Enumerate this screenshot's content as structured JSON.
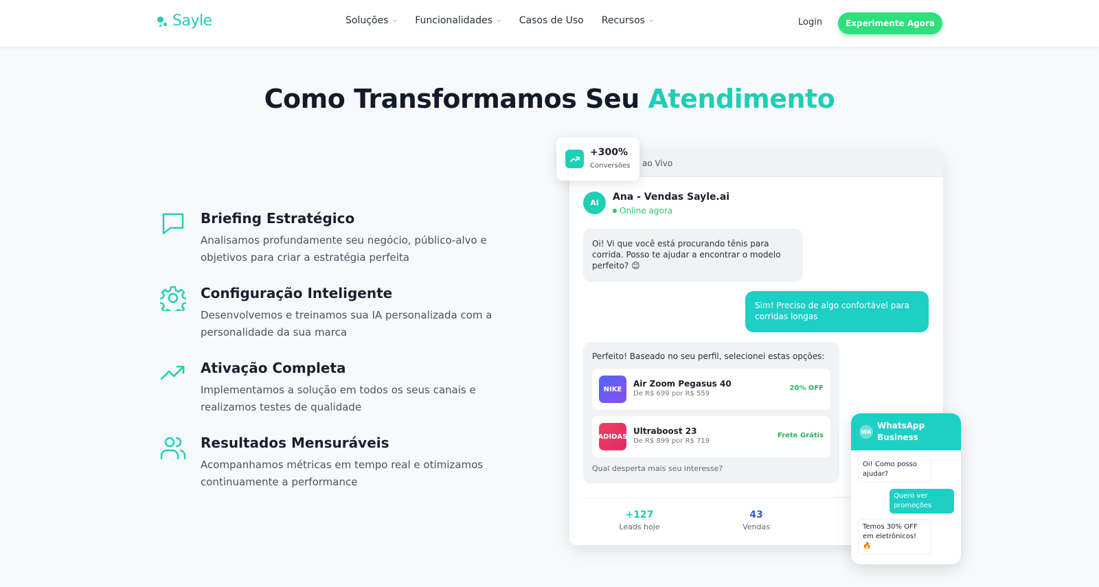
{
  "brand": {
    "name": "Sayle",
    "accent": "#1ecfb5",
    "cta_color": "#2ee07c"
  },
  "nav": {
    "items": [
      {
        "label": "Soluções",
        "has_dropdown": true
      },
      {
        "label": "Funcionalidades",
        "has_dropdown": true
      },
      {
        "label": "Casos de Uso",
        "has_dropdown": false
      },
      {
        "label": "Recursos",
        "has_dropdown": true
      }
    ],
    "login": "Login",
    "cta": "Experimente Agora"
  },
  "hero": {
    "title_main": "Como Transformamos Seu ",
    "title_accent": "Atendimento"
  },
  "steps": [
    {
      "icon": "chat-bubble-icon",
      "title": "Briefing Estratégico",
      "description": "Analisamos profundamente seu negócio, público-alvo e objetivos para criar a estratégia perfeita"
    },
    {
      "icon": "gear-icon",
      "title": "Configuração Inteligente",
      "description": "Desenvolvemos e treinamos sua IA personalizada com a personalidade da sua marca"
    },
    {
      "icon": "trending-up-icon",
      "title": "Ativação Completa",
      "description": "Implementamos a solução em todos os seus canais e realizamos testes de qualidade"
    },
    {
      "icon": "users-icon",
      "title": "Resultados Mensuráveis",
      "description": "Acompanhamos métricas em tempo real e otimizamos continuamente a performance"
    }
  ],
  "chat": {
    "topbar": "ao Vivo",
    "agent": {
      "initials": "AI",
      "name": "Ana - Vendas Sayle.ai",
      "status": "Online agora"
    },
    "message_in": "Oi! Vi que você está procurando tênis para corrida. Posso te ajudar a encontrar o modelo perfeito? 😊",
    "message_out": "Sim! Preciso de algo confortável para corridas longas",
    "offer_intro": "Perfeito! Baseado no seu perfil, selecionei estas opções:",
    "products": [
      {
        "brand": "NIKE",
        "name": "Air Zoom Pegasus 40",
        "price": "De R$ 699 por R$ 559",
        "tag": "20% OFF"
      },
      {
        "brand": "ADIDAS",
        "name": "Ultraboost 23",
        "price": "De R$ 899 por R$ 719",
        "tag": "Frete Grátis"
      }
    ],
    "offer_question": "Qual desperta mais seu interesse?",
    "stats": [
      {
        "value": "+127",
        "label": "Leads hoje",
        "color": "#1ecfb5"
      },
      {
        "value": "43",
        "label": "Vendas",
        "color": "#2b5fd9"
      }
    ]
  },
  "badge": {
    "value": "+300%",
    "label": "Conversões"
  },
  "whatsapp": {
    "avatar": "WA",
    "title": "WhatsApp Business",
    "messages": [
      {
        "from": "in",
        "text": "Oi! Como posso ajudar?"
      },
      {
        "from": "out",
        "text": "Quero ver promoções"
      },
      {
        "from": "in",
        "text": "Temos 30% OFF em eletrônicos! 🔥"
      }
    ]
  }
}
